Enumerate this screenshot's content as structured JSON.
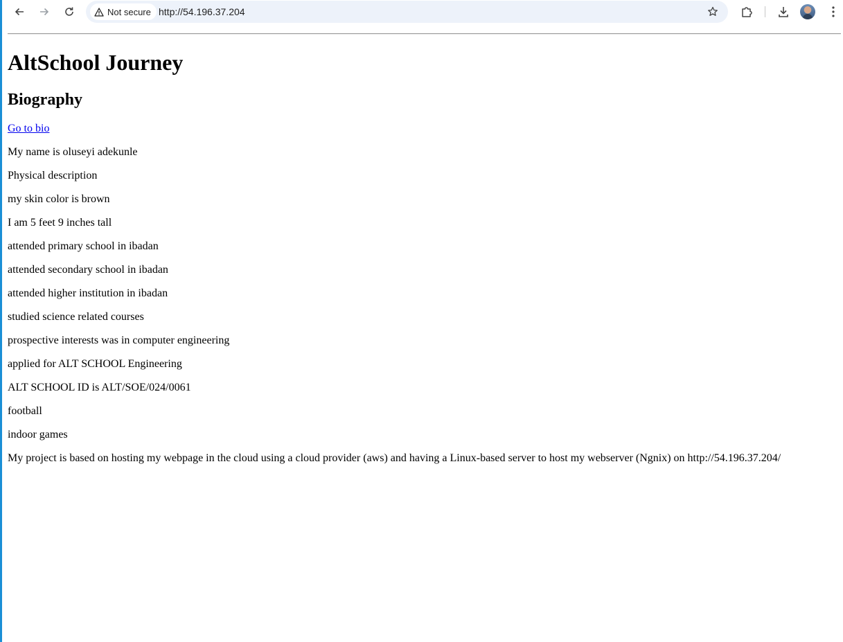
{
  "browser": {
    "security_label": "Not secure",
    "url": "http://54.196.37.204"
  },
  "page": {
    "title": "AltSchool Journey",
    "section_heading": "Biography",
    "link_text": "Go to bio",
    "paragraphs": [
      "My name is oluseyi adekunle",
      "Physical description",
      "my skin color is brown",
      "I am 5 feet 9 inches tall",
      "attended primary school in ibadan",
      "attended secondary school in ibadan",
      "attended higher institution in ibadan",
      "studied science related courses",
      "prospective interests was in computer engineering",
      "applied for ALT SCHOOL Engineering",
      "ALT SCHOOL ID is ALT/SOE/024/0061",
      "football",
      "indoor games",
      "My project is based on hosting my webpage in the cloud using a cloud provider (aws) and having a Linux-based server to host my webserver (Ngnix) on http://54.196.37.204/"
    ]
  }
}
